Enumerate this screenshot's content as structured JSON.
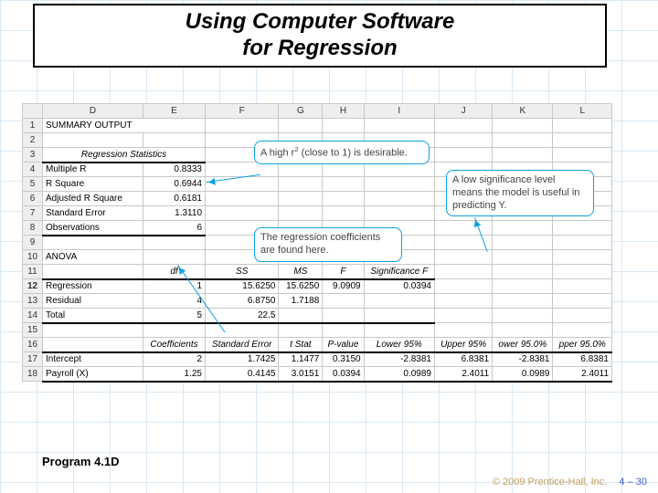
{
  "title": "Using Computer Software\nfor Regression",
  "columns": [
    "",
    "D",
    "E",
    "F",
    "G",
    "H",
    "I",
    "J",
    "K",
    "L"
  ],
  "rows": {
    "1": {
      "D": "SUMMARY OUTPUT"
    },
    "3": {
      "D": "Regression Statistics"
    },
    "4": {
      "D": "Multiple R",
      "E": "0.8333"
    },
    "5": {
      "D": "R Square",
      "E": "0.6944"
    },
    "6": {
      "D": "Adjusted R Square",
      "E": "0.6181"
    },
    "7": {
      "D": "Standard Error",
      "E": "1.3110"
    },
    "8": {
      "D": "Observations",
      "E": "6"
    },
    "10": {
      "D": "ANOVA"
    },
    "11": {
      "E": "df",
      "F": "SS",
      "G": "MS",
      "H": "F",
      "I": "Significance F"
    },
    "12": {
      "D": "Regression",
      "E": "1",
      "F": "15.6250",
      "G": "15.6250",
      "H": "9.0909",
      "I": "0.0394"
    },
    "13": {
      "D": "Residual",
      "E": "4",
      "F": "6.8750",
      "G": "1.7188"
    },
    "14": {
      "D": "Total",
      "E": "5",
      "F": "22.5"
    },
    "16": {
      "E": "Coefficients",
      "F": "Standard Error",
      "G": "t Stat",
      "H": "P-value",
      "I": "Lower 95%",
      "J": "Upper 95%",
      "K": "ower 95.0%",
      "L": "pper 95.0%"
    },
    "17": {
      "D": "Intercept",
      "E": "2",
      "F": "1.7425",
      "G": "1.1477",
      "H": "0.3150",
      "I": "-2.8381",
      "J": "6.8381",
      "K": "-2.8381",
      "L": "6.8381"
    },
    "18": {
      "D": "Payroll (X)",
      "E": "1.25",
      "F": "0.4145",
      "G": "3.0151",
      "H": "0.0394",
      "I": "0.0989",
      "J": "2.4011",
      "K": "0.0989",
      "L": "2.4011"
    }
  },
  "callouts": {
    "r2_pre": "A high r",
    "r2_suf": " (close to 1) is desirable.",
    "sig": "A low significance level means the model is useful in predicting Y.",
    "coef": "The regression coefficients are found here."
  },
  "caption": "Program 4.1D",
  "footer": {
    "copy": "© 2009 Prentice-Hall, Inc.",
    "page": "4 – 30"
  }
}
